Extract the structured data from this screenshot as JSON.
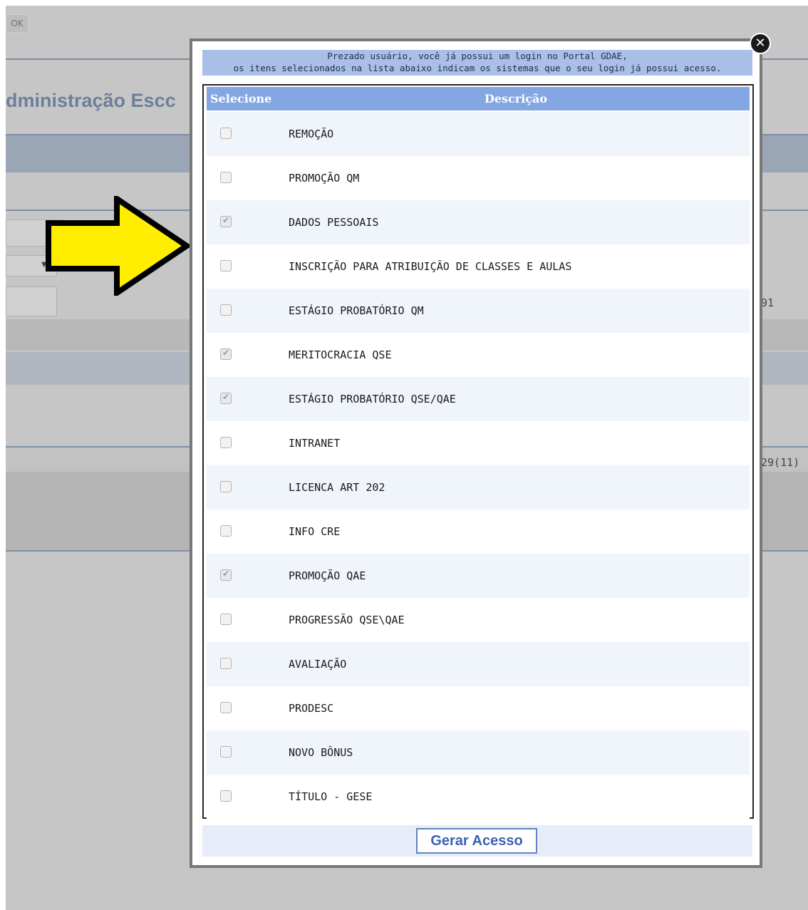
{
  "background": {
    "ok_button": "OK",
    "title_partial": "dministração Escc",
    "right_value_1": "91",
    "right_value_2": "29(11)"
  },
  "modal": {
    "notice_line1": "Prezado usuário, você já possui um login no Portal GDAE,",
    "notice_line2": "os itens selecionados na lista abaixo indicam os sistemas que o seu login já possui acesso.",
    "columns": {
      "select": "Selecione",
      "description": "Descrição"
    },
    "rows": [
      {
        "label": "REMOÇÃO",
        "checked": false
      },
      {
        "label": "PROMOÇÃO QM",
        "checked": false
      },
      {
        "label": "DADOS PESSOAIS",
        "checked": true
      },
      {
        "label": "INSCRIÇÃO PARA ATRIBUIÇÃO DE CLASSES E AULAS",
        "checked": false
      },
      {
        "label": "ESTÁGIO PROBATÓRIO QM",
        "checked": false
      },
      {
        "label": "MERITOCRACIA QSE",
        "checked": true
      },
      {
        "label": "ESTÁGIO PROBATÓRIO QSE/QAE",
        "checked": true
      },
      {
        "label": "INTRANET",
        "checked": false
      },
      {
        "label": "LICENCA ART 202",
        "checked": false
      },
      {
        "label": "INFO CRE",
        "checked": false
      },
      {
        "label": "PROMOÇÃO QAE",
        "checked": true
      },
      {
        "label": "PROGRESSÃO QSE\\QAE",
        "checked": false
      },
      {
        "label": "AVALIAÇÃO",
        "checked": false
      },
      {
        "label": "PRODESC",
        "checked": false
      },
      {
        "label": "NOVO BÔNUS",
        "checked": false
      },
      {
        "label": "TÍTULO - GESE",
        "checked": false
      }
    ],
    "generate_button": "Gerar Acesso",
    "close_icon": "close-icon"
  },
  "colors": {
    "header_blue": "#84a6e3",
    "notice_blue": "#a9bfe8",
    "arrow_yellow": "#ffee00",
    "button_text": "#3b62b3"
  }
}
